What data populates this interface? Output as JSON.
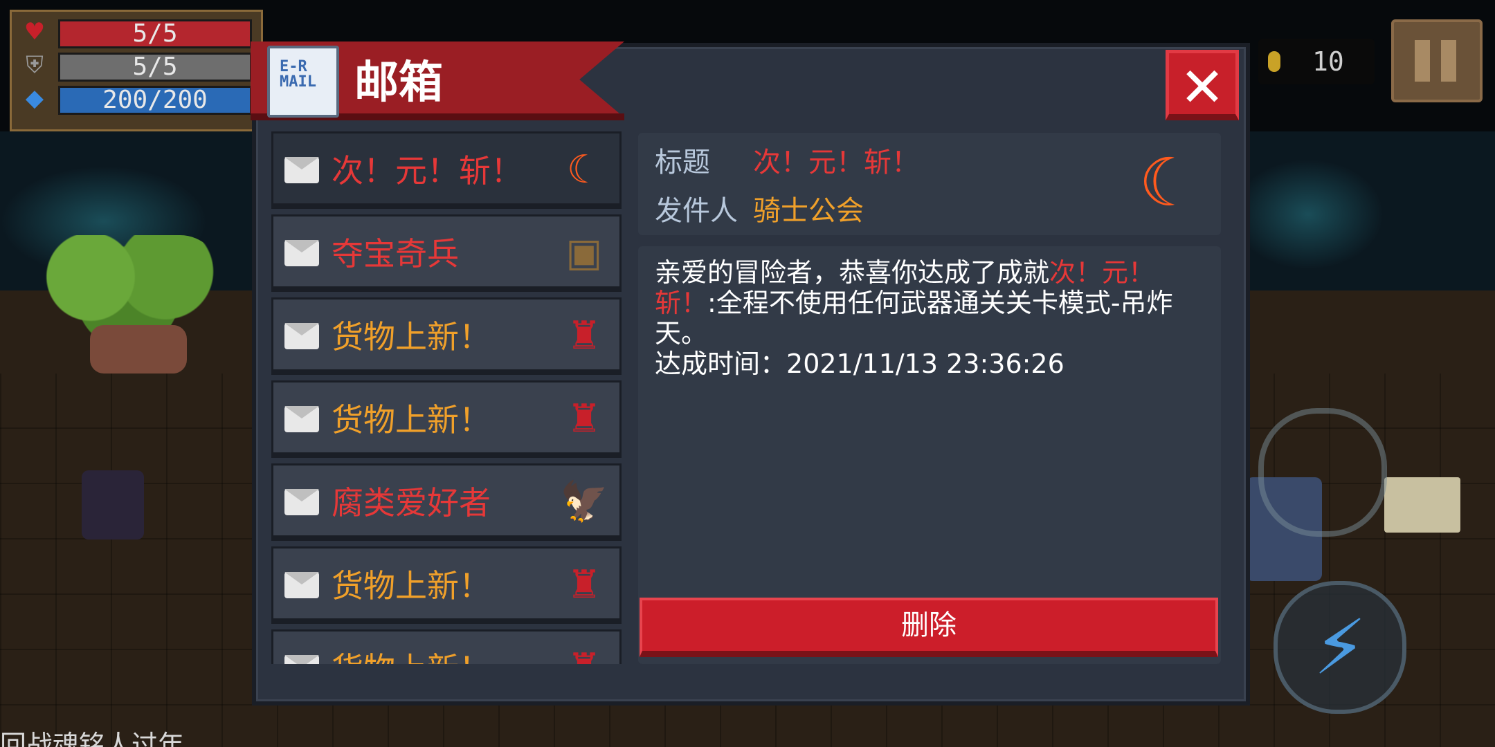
{
  "hud": {
    "hp": "5/5",
    "armor": "5/5",
    "energy": "200/200",
    "coins": "10",
    "hp_icon": "heart-icon",
    "armor_icon": "shield-icon",
    "energy_icon": "diamond-icon"
  },
  "mailbox": {
    "title": "邮箱",
    "icon_label": "E-R\nMAIL",
    "close_symbol": "✕"
  },
  "mail_list": [
    {
      "name": "次！元！斩！",
      "color": "#e63838",
      "thumb": "moon-blade-icon",
      "selected": true
    },
    {
      "name": "夺宝奇兵",
      "color": "#e63838",
      "thumb": "treasure-icon",
      "selected": false
    },
    {
      "name": "货物上新！",
      "color": "#f0a02a",
      "thumb": "merchant-icon",
      "selected": false
    },
    {
      "name": "货物上新！",
      "color": "#f0a02a",
      "thumb": "merchant-icon",
      "selected": false
    },
    {
      "name": "腐类爱好者",
      "color": "#e63838",
      "thumb": "eagle-icon",
      "selected": false
    },
    {
      "name": "货物上新！",
      "color": "#f0a02a",
      "thumb": "merchant-icon",
      "selected": false
    },
    {
      "name": "货物上新！",
      "color": "#f0a02a",
      "thumb": "merchant-icon",
      "selected": false
    }
  ],
  "detail": {
    "title_label": "标题",
    "title_value": "次！元！斩！",
    "sender_label": "发件人",
    "sender_value": "骑士公会",
    "body_part1": "亲爱的冒险者，恭喜你达成了成就",
    "body_highlight": "次！元！斩！",
    "body_part2": ":全程不使用任何武器通关关卡模式-吊炸天。",
    "time_label": "达成时间：",
    "time_value": "2021/11/13 23:36:26",
    "delete_label": "删除"
  },
  "bottom_text": "回战魂铭人过年"
}
